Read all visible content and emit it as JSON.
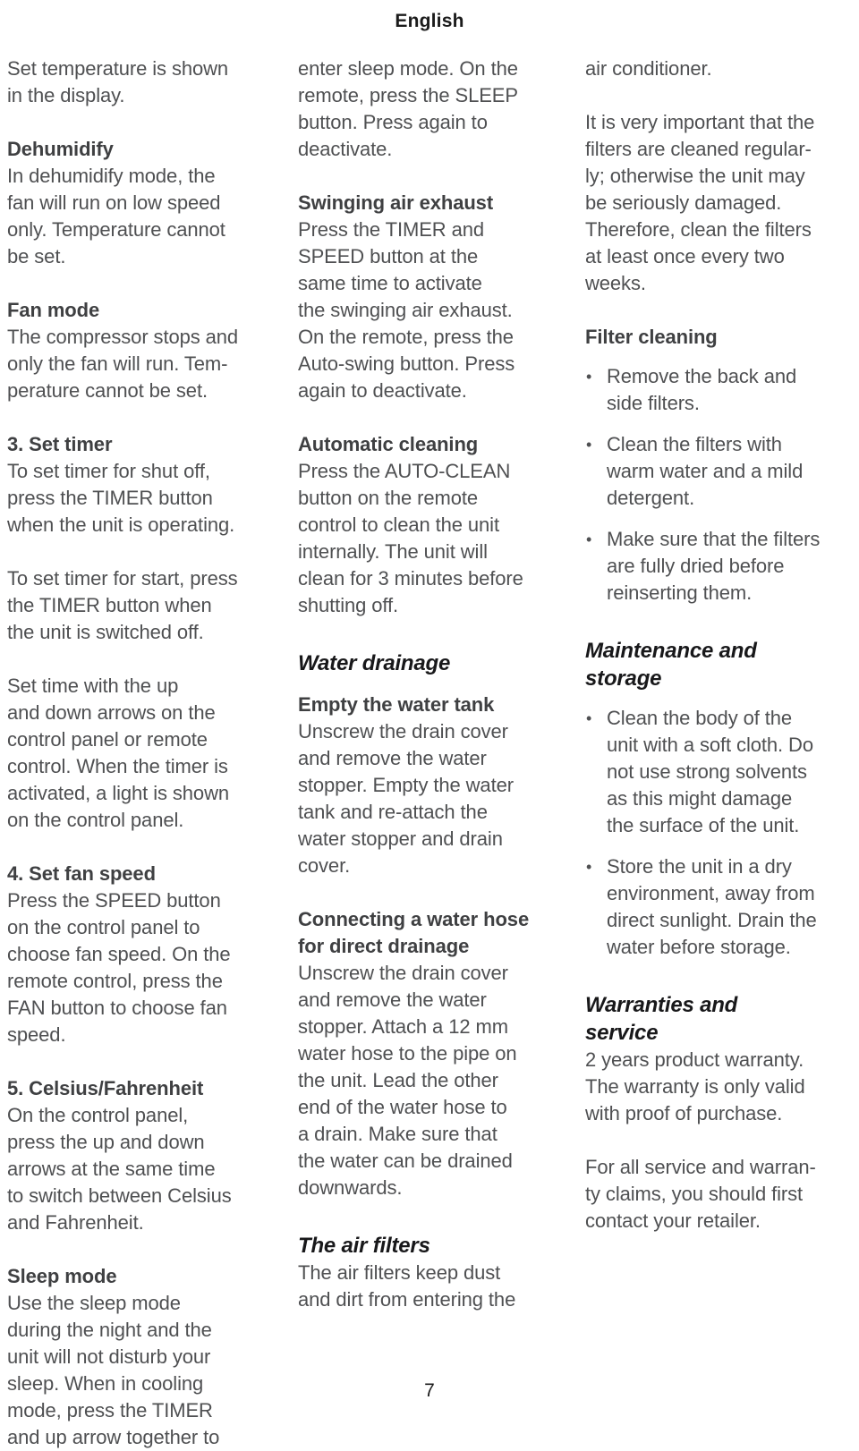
{
  "header": {
    "title": "English"
  },
  "footer": {
    "page_number": "7"
  },
  "colors": {
    "body_text": "#4f5052",
    "heading_text": "#18181a",
    "subheading_text": "#3f4042",
    "background": "#ffffff"
  },
  "columns": {
    "left": {
      "blocks": [
        {
          "kind": "paragraph",
          "text": "Set temperature is shown\nin the display."
        },
        {
          "kind": "subheading",
          "text": "Dehumidify"
        },
        {
          "kind": "paragraph",
          "text": "In dehumidify mode, the\nfan will run on low speed\nonly. Temperature cannot\nbe set."
        },
        {
          "kind": "subheading",
          "text": "Fan mode"
        },
        {
          "kind": "paragraph",
          "text": "The compressor stops and\nonly the fan will run. Tem-\nperature cannot be set."
        },
        {
          "kind": "subheading",
          "text": "3. Set timer"
        },
        {
          "kind": "paragraph",
          "text": "To set timer for shut off,\npress the TIMER button\nwhen the unit is operating."
        },
        {
          "kind": "paragraph",
          "text": "To set timer for start, press\nthe TIMER button when\nthe unit is switched off."
        },
        {
          "kind": "paragraph",
          "text": "Set time with the up\nand down arrows on the\ncontrol panel or remote\ncontrol. When the timer is\nactivated, a light is shown\non the control panel."
        },
        {
          "kind": "subheading",
          "text": "4. Set fan speed"
        },
        {
          "kind": "paragraph",
          "text": "Press the SPEED button\non the control panel to\nchoose fan speed. On the\nremote control, press the\nFAN button to choose fan\nspeed."
        },
        {
          "kind": "subheading",
          "text": "5. Celsius/Fahrenheit"
        },
        {
          "kind": "paragraph",
          "text": "On the control panel,\npress the up and down\narrows at the same time\nto switch between Celsius\nand Fahrenheit."
        },
        {
          "kind": "subheading",
          "text": "Sleep mode"
        },
        {
          "kind": "paragraph",
          "text": "Use the sleep mode\nduring the night and the\nunit will not disturb your\nsleep. When in cooling\nmode, press the TIMER\nand up arrow together to"
        }
      ]
    },
    "middle": {
      "blocks": [
        {
          "kind": "paragraph",
          "text": "enter sleep mode. On the\nremote, press the SLEEP\nbutton. Press again to\ndeactivate."
        },
        {
          "kind": "subheading",
          "text": "Swinging air exhaust"
        },
        {
          "kind": "paragraph",
          "text": "Press the TIMER and\nSPEED button at the\nsame time to activate\nthe swinging air exhaust.\nOn the remote, press the\nAuto-swing button. Press\nagain to deactivate."
        },
        {
          "kind": "subheading",
          "text": "Automatic cleaning"
        },
        {
          "kind": "paragraph",
          "text": "Press the AUTO-CLEAN\nbutton on the remote\ncontrol to clean the unit\ninternally. The unit will\nclean for 3 minutes before\nshutting off."
        },
        {
          "kind": "section",
          "text": "Water drainage"
        },
        {
          "kind": "subheading",
          "text": "Empty the water tank"
        },
        {
          "kind": "paragraph",
          "text": "Unscrew the drain cover\nand remove the water\nstopper. Empty the water\ntank and re-attach the\nwater stopper and drain\ncover."
        },
        {
          "kind": "subheading",
          "text": "Connecting a water hose\nfor direct drainage"
        },
        {
          "kind": "paragraph",
          "text": "Unscrew the drain cover\nand remove the water\nstopper. Attach a 12 mm\nwater hose to the pipe on\nthe unit. Lead the other\nend of the water hose to\na drain. Make sure that\nthe water can be drained\ndownwards."
        },
        {
          "kind": "section",
          "text": "The air filters"
        },
        {
          "kind": "paragraph",
          "text": "The air filters keep dust\nand dirt from entering the"
        }
      ]
    },
    "right": {
      "blocks": [
        {
          "kind": "paragraph",
          "text": "air conditioner."
        },
        {
          "kind": "paragraph",
          "text": "It is very important that the\nfilters are cleaned regular-\nly; otherwise the unit may\nbe seriously damaged.\nTherefore, clean the filters\nat least once every two\nweeks."
        },
        {
          "kind": "subheading",
          "text": "Filter cleaning"
        },
        {
          "kind": "bullets",
          "items": [
            "Remove the back and\nside filters.",
            "Clean the filters with\nwarm water and a mild\ndetergent.",
            "Make sure that the filters\nare fully dried before\nreinserting them."
          ]
        },
        {
          "kind": "section",
          "text": "Maintenance and\nstorage"
        },
        {
          "kind": "bullets",
          "items": [
            "Clean the body of the\nunit with a soft cloth. Do\nnot use strong solvents\nas this might damage\nthe surface of the unit.",
            "Store the unit in a dry\nenvironment, away from\ndirect sunlight. Drain the\nwater before storage."
          ]
        },
        {
          "kind": "section",
          "text": "Warranties and\nservice"
        },
        {
          "kind": "paragraph",
          "text": "2 years product warranty.\nThe warranty is only valid\nwith proof of purchase."
        },
        {
          "kind": "paragraph",
          "text": "For all service and warran-\nty claims, you should first\ncontact your retailer."
        }
      ]
    }
  }
}
